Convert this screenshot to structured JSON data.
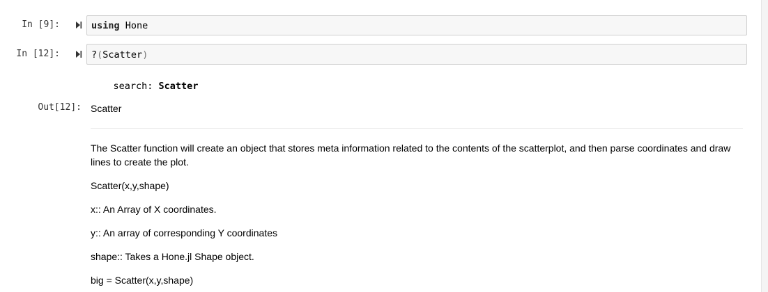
{
  "cells": {
    "cell1": {
      "prompt": "In [9]:",
      "code_keyword": "using",
      "code_rest": " Hone"
    },
    "cell2": {
      "prompt": "In [12]:",
      "code_prefix": "?",
      "code_open_paren": "(",
      "code_arg": "Scatter",
      "code_close_paren": ")",
      "stream_label": "search: ",
      "stream_value": "Scatter",
      "out_prompt": "Out[12]:"
    }
  },
  "doc": {
    "heading": "Scatter",
    "paragraphs": [
      "The Scatter function will create an object that stores meta information related to the contents of the scatterplot, and then parse coordinates and draw lines to create the plot.",
      "Scatter(x,y,shape)",
      "x:: An Array of X coordinates.",
      "y:: An array of corresponding Y coordinates",
      "shape:: Takes a Hone.jl Shape object.",
      "big = Scatter(x,y,shape)"
    ]
  },
  "icons": {
    "run": "step-forward-icon"
  },
  "colors": {
    "input_bg": "#f7f7f7",
    "input_border": "#cfcfcf",
    "prompt_text": "#333333",
    "divider": "#e8e8e8"
  }
}
